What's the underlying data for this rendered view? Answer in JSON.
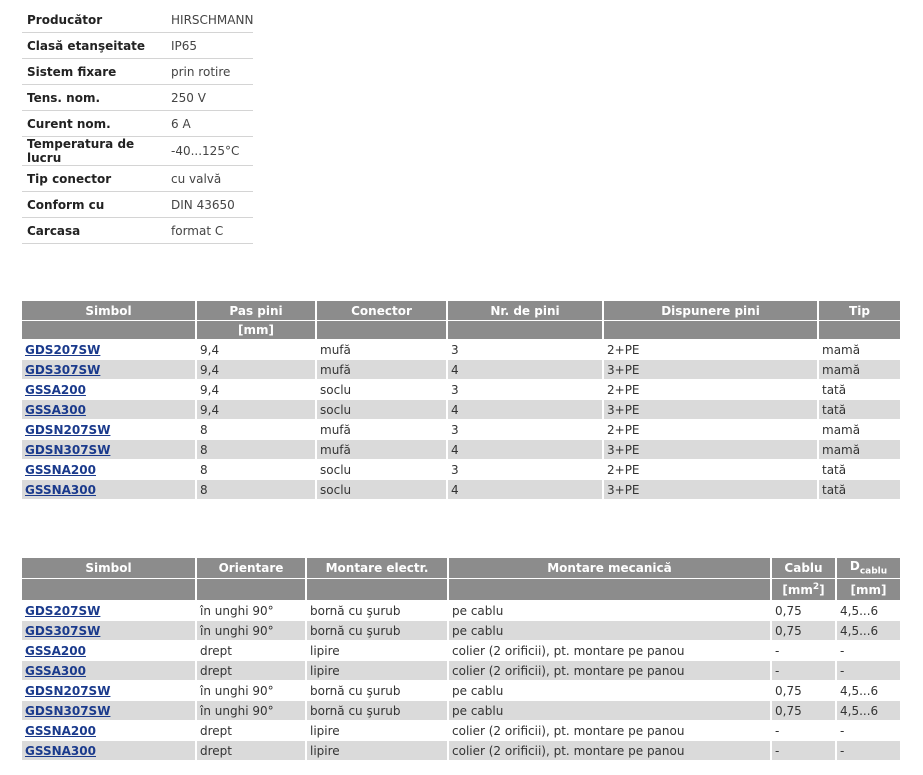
{
  "specs": [
    {
      "label": "Producător",
      "value": "HIRSCHMANN"
    },
    {
      "label": "Clasă etanşeitate",
      "value": "IP65"
    },
    {
      "label": "Sistem fixare",
      "value": "prin rotire"
    },
    {
      "label": "Tens. nom.",
      "value": "250 V"
    },
    {
      "label": "Curent nom.",
      "value": "6 A"
    },
    {
      "label": "Temperatura de lucru",
      "value": "-40...125°C"
    },
    {
      "label": "Tip conector",
      "value": "cu valvă"
    },
    {
      "label": "Conform cu",
      "value": "DIN 43650"
    },
    {
      "label": "Carcasa",
      "value": "format C"
    }
  ],
  "table1": {
    "headers": [
      "Simbol",
      "Pas pini",
      "Conector",
      "Nr. de pini",
      "Dispunere pini",
      "Tip"
    ],
    "units": [
      "",
      "[mm]",
      "",
      "",
      "",
      ""
    ],
    "rows": [
      [
        "GDS207SW",
        "9,4",
        "mufă",
        "3",
        "2+PE",
        "mamă"
      ],
      [
        "GDS307SW",
        "9,4",
        "mufă",
        "4",
        "3+PE",
        "mamă"
      ],
      [
        "GSSA200",
        "9,4",
        "soclu",
        "3",
        "2+PE",
        "tată"
      ],
      [
        "GSSA300",
        "9,4",
        "soclu",
        "4",
        "3+PE",
        "tată"
      ],
      [
        "GDSN207SW",
        "8",
        "mufă",
        "3",
        "2+PE",
        "mamă"
      ],
      [
        "GDSN307SW",
        "8",
        "mufă",
        "4",
        "3+PE",
        "mamă"
      ],
      [
        "GSSNA200",
        "8",
        "soclu",
        "3",
        "2+PE",
        "tată"
      ],
      [
        "GSSNA300",
        "8",
        "soclu",
        "4",
        "3+PE",
        "tată"
      ]
    ]
  },
  "table2": {
    "headers": [
      "Simbol",
      "Orientare",
      "Montare electr.",
      "Montare mecanică",
      "Cablu",
      "D"
    ],
    "header_sub": "cablu",
    "units": [
      "",
      "",
      "",
      "",
      "[mm",
      "[mm]"
    ],
    "unit_sup": "2",
    "unit_close": "]",
    "rows": [
      [
        "GDS207SW",
        "în unghi 90°",
        "bornă cu şurub",
        "pe cablu",
        "0,75",
        "4,5...6"
      ],
      [
        "GDS307SW",
        "în unghi 90°",
        "bornă cu şurub",
        "pe cablu",
        "0,75",
        "4,5...6"
      ],
      [
        "GSSA200",
        "drept",
        "lipire",
        "colier (2 orificii), pt. montare pe panou",
        "-",
        "-"
      ],
      [
        "GSSA300",
        "drept",
        "lipire",
        "colier (2 orificii), pt. montare pe panou",
        "-",
        "-"
      ],
      [
        "GDSN207SW",
        "în unghi 90°",
        "bornă cu şurub",
        "pe cablu",
        "0,75",
        "4,5...6"
      ],
      [
        "GDSN307SW",
        "în unghi 90°",
        "bornă cu şurub",
        "pe cablu",
        "0,75",
        "4,5...6"
      ],
      [
        "GSSNA200",
        "drept",
        "lipire",
        "colier (2 orificii), pt. montare pe panou",
        "-",
        "-"
      ],
      [
        "GSSNA300",
        "drept",
        "lipire",
        "colier (2 orificii), pt. montare pe panou",
        "-",
        "-"
      ]
    ]
  }
}
